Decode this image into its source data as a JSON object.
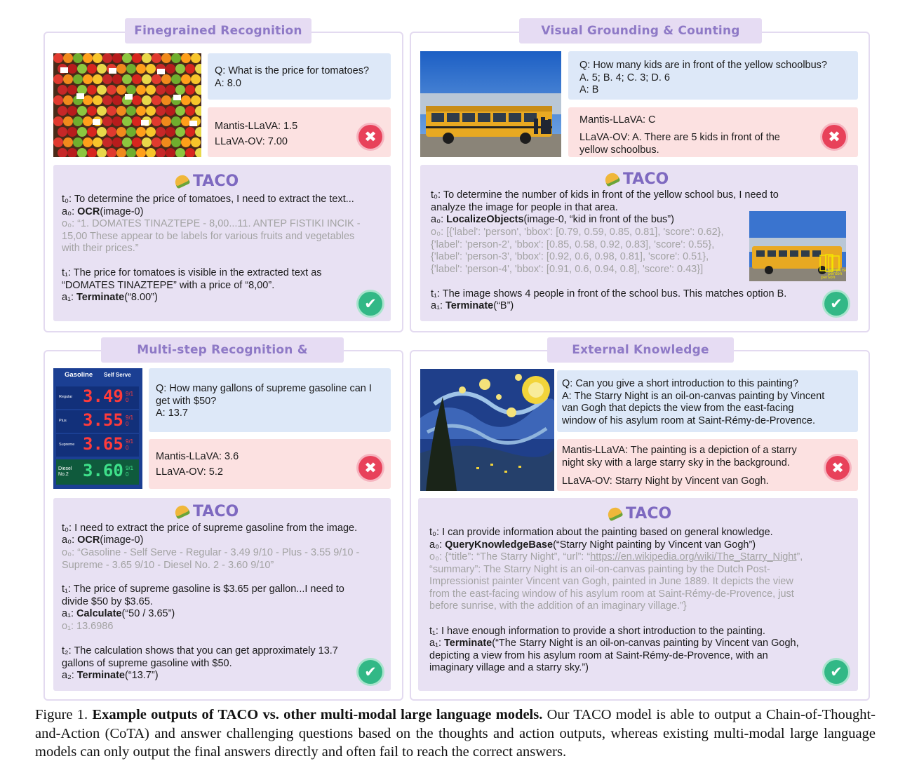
{
  "panels": {
    "fine": {
      "title": "Finegrained  Recognition",
      "q1": "Q: What is the price for tomatoes?",
      "q2": "A: 8.0",
      "m1": "Mantis-LLaVA: 1.5",
      "m2": "LLaVA-OV: 7.00",
      "taco": "TACO",
      "t0_label": "t₀:",
      "t0": " To determine the price of tomatoes, I need to extract the text...",
      "a0_label": "a₀: ",
      "a0_fn": "OCR",
      "a0_arg": "(image-0)",
      "o0_l1": "o₀: “1. DOMATES TINAZTEPE - 8,00...11. ANTEP FISTIKI INCIK -",
      "o0_l2": "15,00 These appear to be labels for various fruits and vegetables",
      "o0_l3": "with their prices.”",
      "t1_l1": "t₁: The price for tomatoes is visible in the extracted text as",
      "t1_l2": "“DOMATES TINAZTEPE” with a price of “8,00”.",
      "a1_label": "a₁: ",
      "a1_fn": "Terminate",
      "a1_arg": "(“8.00”)"
    },
    "visual": {
      "title": "Visual Grounding & Counting",
      "q1": "Q: How many kids are in front of the yellow schoolbus?",
      "q2": "A. 5; B. 4; C. 3; D. 6",
      "q3": "A: B",
      "m1": "Mantis-LLaVA: C",
      "m2": "LLaVA-OV: A. There are 5 kids in front of the",
      "m3": "yellow schoolbus.",
      "taco": "TACO",
      "t0_l1": "t₀: To determine the number of kids in front of the yellow school bus, I need to",
      "t0_l2": "analyze the image for people in that area.",
      "a0_label": "a₀: ",
      "a0_fn": "LocalizeObjects",
      "a0_arg": "(image-0, “kid in front of the bus”)",
      "o0_l1": "o₀: [{'label': 'person', 'bbox': [0.79, 0.59, 0.85, 0.81], 'score': 0.62},",
      "o0_l2": "{'label': 'person-2', 'bbox': [0.85, 0.58, 0.92, 0.83], 'score': 0.55},",
      "o0_l3": "{'label': 'person-3', 'bbox': [0.92, 0.6, 0.98, 0.81], 'score': 0.51},",
      "o0_l4": "{'label': 'person-4', 'bbox': [0.91, 0.6, 0.94, 0.8], 'score': 0.43}]",
      "t1": "t₁: The image shows 4 people in front of the school bus. This matches option B.",
      "a1_label": "a₁: ",
      "a1_fn": "Terminate",
      "a1_arg": "(“B”)",
      "bbox_label": "person"
    },
    "multi": {
      "title": "Multi-step Recognition & Reasoning",
      "q1": "Q: How many gallons of supreme gasoline can I",
      "q2": "get with $50?",
      "q3": "A: 13.7",
      "m1": "Mantis-LLaVA: 3.6",
      "m2": "LLaVA-OV: 5.2",
      "taco": "TACO",
      "t0": "t₀: I need to extract the price of supreme gasoline from the image.",
      "a0_label": "a₀: ",
      "a0_fn": "OCR",
      "a0_arg": "(image-0)",
      "o0_l1": "o₀: “Gasoline - Self Serve - Regular - 3.49 9/10 - Plus - 3.55 9/10 -",
      "o0_l2": "Supreme - 3.65 9/10 - Diesel No. 2 - 3.60 9/10”",
      "t1_l1": "t₁: The price of supreme gasoline is $3.65 per gallon...I need to",
      "t1_l2": "divide $50 by $3.65.",
      "a1_label": "a₁: ",
      "a1_fn": "Calculate",
      "a1_arg": "(“50 / 3.65”)",
      "o1": "o₁: 13.6986",
      "t2_l1": "t₂: The calculation shows that you can get approximately 13.7",
      "t2_l2": "gallons of supreme gasoline with $50.",
      "a2_label": "a₂: ",
      "a2_fn": "Terminate",
      "a2_arg": "(“13.7”)",
      "sign": {
        "header": "Gasoline",
        "header2": "Self Serve",
        "rows": [
          {
            "label": "Regular",
            "price": "3.49",
            "frac": "9/10"
          },
          {
            "label": "Plus",
            "price": "3.55",
            "frac": "9/10"
          },
          {
            "label": "Supreme",
            "price": "3.65",
            "frac": "9/10"
          },
          {
            "label": "Diesel No.2",
            "price": "3.60",
            "frac": "9/10"
          }
        ]
      }
    },
    "ext": {
      "title": "External Knowledge",
      "q1": "Q: Can you give a short introduction to this painting?",
      "q2": "A: The Starry Night is an oil-on-canvas painting by Vincent",
      "q3": "van Gogh that depicts the view from the east-facing",
      "q4": "window of his asylum room at Saint-Rémy-de-Provence.",
      "m1": "Mantis-LLaVA: The painting is a depiction of a starry",
      "m2": "night sky with a large starry sky in the background.",
      "m3": "LLaVA-OV: Starry Night by Vincent van Gogh.",
      "taco": "TACO",
      "t0": "t₀: I can provide information about the painting based on general knowledge.",
      "a0_label": "a₀: ",
      "a0_fn": "QueryKnowledgeBase",
      "a0_arg": "(“Starry Night painting by Vincent van Gogh”)",
      "o0_pre": "o₀: {“title”: “The Starry Night”, “url”: “",
      "o0_url": "https://en.wikipedia.org/wiki/The_Starry_Night",
      "o0_post": "”,",
      "o0_l2": "“summary”: The Starry Night is an oil-on-canvas painting by the Dutch Post-",
      "o0_l3": "Impressionist painter Vincent van Gogh, painted in June 1889. It depicts the view",
      "o0_l4": "from the east-facing window of his asylum room at Saint-Rémy-de-Provence, just",
      "o0_l5": "before sunrise, with the addition of an imaginary village.”}",
      "t1": "t₁: I have enough information to provide a short introduction to the painting.",
      "a1_label": "a₁: ",
      "a1_fn": "Terminate",
      "a1_l1": "(“The Starry Night is an oil-on-canvas painting by Vincent van Gogh,",
      "a1_l2": "depicting a view from his asylum room at Saint-Rémy-de-Provence, with an",
      "a1_l3": "imaginary village and a starry sky.”)"
    }
  },
  "badges": {
    "wrong": "✖",
    "right": "✔"
  },
  "caption": {
    "label": "Figure 1. ",
    "bold": "Example outputs of TACO vs. other multi-modal large language models.",
    "rest": " Our TACO model is able to output a Chain-of-Thought-and-Action (CoTA) and answer challenging questions based on the thoughts and action outputs, whereas existing multi-modal large language models can only output the final answers directly and often fail to reach the correct answers."
  },
  "colors": {
    "tab": "#e6dcf3",
    "tab_text": "#8e79c6",
    "question": "#dde8f8",
    "baseline": "#fce1e1",
    "taco": "#e8e1f3",
    "wrong": "#e8415a",
    "right": "#32b886"
  }
}
